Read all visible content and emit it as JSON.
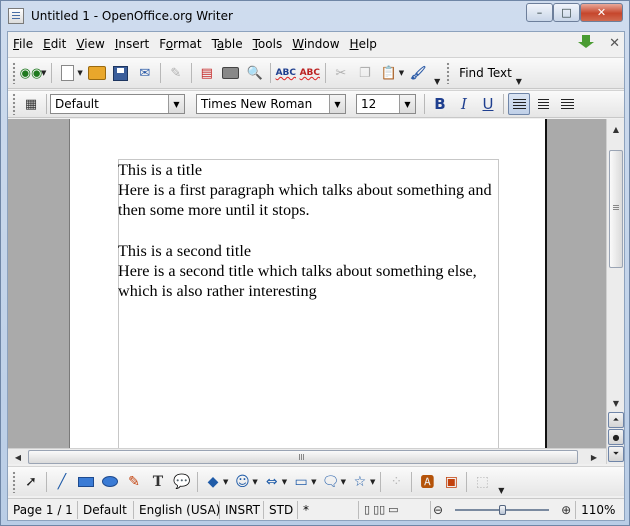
{
  "window": {
    "title": "Untitled 1 - OpenOffice.org Writer",
    "controls": {
      "minimize": "–",
      "maximize": "□",
      "close": "✕"
    }
  },
  "menu": {
    "items": [
      {
        "key": "file",
        "underline": "F",
        "rest": "ile"
      },
      {
        "key": "edit",
        "underline": "E",
        "rest": "dit"
      },
      {
        "key": "view",
        "underline": "V",
        "rest": "iew"
      },
      {
        "key": "insert",
        "underline": "I",
        "rest": "nsert"
      },
      {
        "key": "format",
        "underline": "F",
        "rest": "ormat",
        "prefix": ""
      },
      {
        "key": "table",
        "underline": "T",
        "rest": "able"
      },
      {
        "key": "tools",
        "underline": "T",
        "rest": "ools"
      },
      {
        "key": "window",
        "underline": "W",
        "rest": "indow"
      },
      {
        "key": "help",
        "underline": "H",
        "rest": "elp"
      }
    ]
  },
  "standard_toolbar": {
    "find_text": "Find Text",
    "spellcheck_label": "ABC",
    "autospell_label": "ABC"
  },
  "format_toolbar": {
    "paragraph_style": "Default",
    "font_name": "Times New Roman",
    "font_size": "12",
    "bold_label": "B",
    "italic_label": "I",
    "underline_label": "U"
  },
  "document": {
    "paragraphs": [
      "This is a title",
      "Here is a first paragraph which talks about something and then some more until it stops.",
      "",
      "This is a second title",
      "Here is a second title which talks about something else, which is also rather interesting"
    ]
  },
  "statusbar": {
    "page": "Page 1 / 1",
    "page_style": "Default",
    "language": "English (USA)",
    "insert_mode": "INSRT",
    "selection_mode": "STD",
    "modified": "*",
    "zoom_minus": "⊖",
    "zoom_plus": "⊕",
    "zoom": "110%",
    "zoom_level_percent": 110
  },
  "colors": {
    "accent": "#2d5ca8",
    "close_button": "#c6462c",
    "page_background": "#ffffff",
    "desk_background": "#aaaaaa"
  },
  "icons": {
    "standard": [
      "binoculars-icon",
      "new-document-icon",
      "open-folder-icon",
      "save-icon",
      "email-icon",
      "edit-file-icon",
      "export-pdf-icon",
      "print-icon",
      "print-preview-icon",
      "spellcheck-icon",
      "autospellcheck-icon",
      "cut-icon",
      "copy-icon",
      "paste-icon",
      "clone-formatting-icon"
    ],
    "drawing": [
      "select-arrow-icon",
      "line-icon",
      "rectangle-icon",
      "ellipse-icon",
      "freeform-icon",
      "text-icon",
      "callout-icon",
      "basic-shapes-icon",
      "symbol-shapes-icon",
      "block-arrows-icon",
      "flowchart-icon",
      "callouts-icon",
      "stars-icon",
      "points-icon",
      "fontwork-icon",
      "extrusion-icon"
    ]
  }
}
